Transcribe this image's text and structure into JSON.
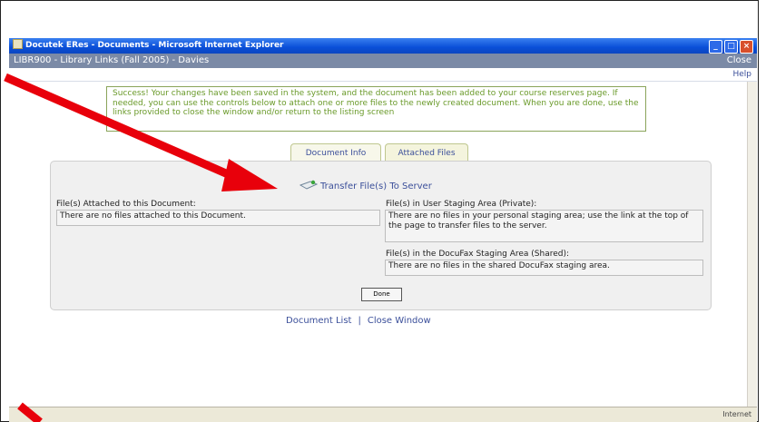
{
  "window": {
    "title": "Docutek ERes - Documents - Microsoft Internet Explorer",
    "course_title": "LIBR900 - Library Links (Fall 2005) - Davies",
    "close_link": "Close",
    "help_link": "Help"
  },
  "success_message": "Success! Your changes have been saved in the system, and the document has been added to your course reserves page. If needed, you can use the controls below to attach one or more files to the newly created document. When you are done, use the links provided to close the window and/or return to the listing screen",
  "tabs": [
    {
      "label": "Document Info",
      "active": false
    },
    {
      "label": "Attached Files",
      "active": true
    }
  ],
  "transfer_link": "Transfer File(s) To Server",
  "attached": {
    "label": "File(s) Attached to this Document:",
    "text": "There are no files attached to this Document."
  },
  "user_staging": {
    "label": "File(s) in User Staging Area (Private):",
    "text": "There are no files in your personal staging area; use the link at the top of the page to transfer files to the server."
  },
  "docufax_staging": {
    "label": "File(s) in the DocuFax Staging Area (Shared):",
    "text": "There are no files in the shared DocuFax staging area."
  },
  "done_button": "Done",
  "footer_links": {
    "document_list": "Document List",
    "separator": "|",
    "close_window": "Close Window"
  },
  "status": {
    "zone": "Internet"
  },
  "colors": {
    "annotation_arrow": "#e8000b",
    "title_bar": "#0a4fd8",
    "course_bar": "#7b8aa6",
    "success_text": "#6a9a2a",
    "link": "#3b4f9a"
  }
}
